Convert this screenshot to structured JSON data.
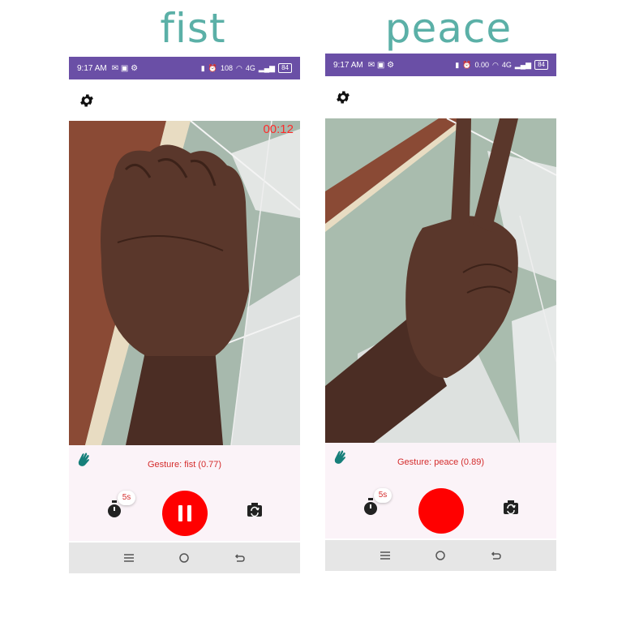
{
  "panels": [
    {
      "title": "fist",
      "status": {
        "time": "9:17 AM",
        "net_speed": "108",
        "net_type": "4G",
        "battery": "84"
      },
      "recording_timer": "00:12",
      "gesture_text": "Gesture: fist (0.77)",
      "timer_badge": "5s",
      "record_state": "recording",
      "icons": [
        "settings-gear-icon",
        "hand-wave-icon",
        "stopwatch-icon",
        "flip-camera-icon",
        "pause-icon"
      ]
    },
    {
      "title": "peace",
      "status": {
        "time": "9:17 AM",
        "net_speed": "0.00",
        "net_type": "4G",
        "battery": "84"
      },
      "recording_timer": "",
      "gesture_text": "Gesture: peace (0.89)",
      "timer_badge": "5s",
      "record_state": "idle",
      "icons": [
        "settings-gear-icon",
        "hand-wave-icon",
        "stopwatch-icon",
        "flip-camera-icon"
      ]
    }
  ],
  "colors": {
    "title": "#5bb0a7",
    "status_bar": "#6a4fa6",
    "record": "#ff0000",
    "gesture_text": "#d42c2c",
    "panel_bg": "#fbf3f8",
    "nav_bar": "#e6e6e6"
  }
}
